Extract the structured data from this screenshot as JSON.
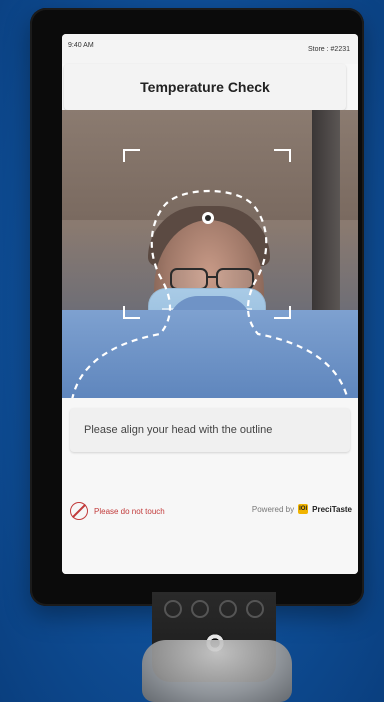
{
  "status_bar": {
    "time": "9:40 AM",
    "store": "Store : #2231"
  },
  "header": {
    "title": "Temperature Check"
  },
  "instruction": {
    "text": "Please align your head with the outline"
  },
  "footer": {
    "no_touch_text": "Please do not touch",
    "powered_by_text": "Powered by",
    "brand": "PreciTaste",
    "brand_logo_text": "IOI"
  },
  "icons": {
    "no_touch": "no-touch-icon",
    "brand_logo": "precitaste-logo-icon"
  },
  "colors": {
    "background_blue": "#0e4f9a",
    "warning_red": "#c23b3b",
    "brand_yellow": "#f1b400"
  }
}
